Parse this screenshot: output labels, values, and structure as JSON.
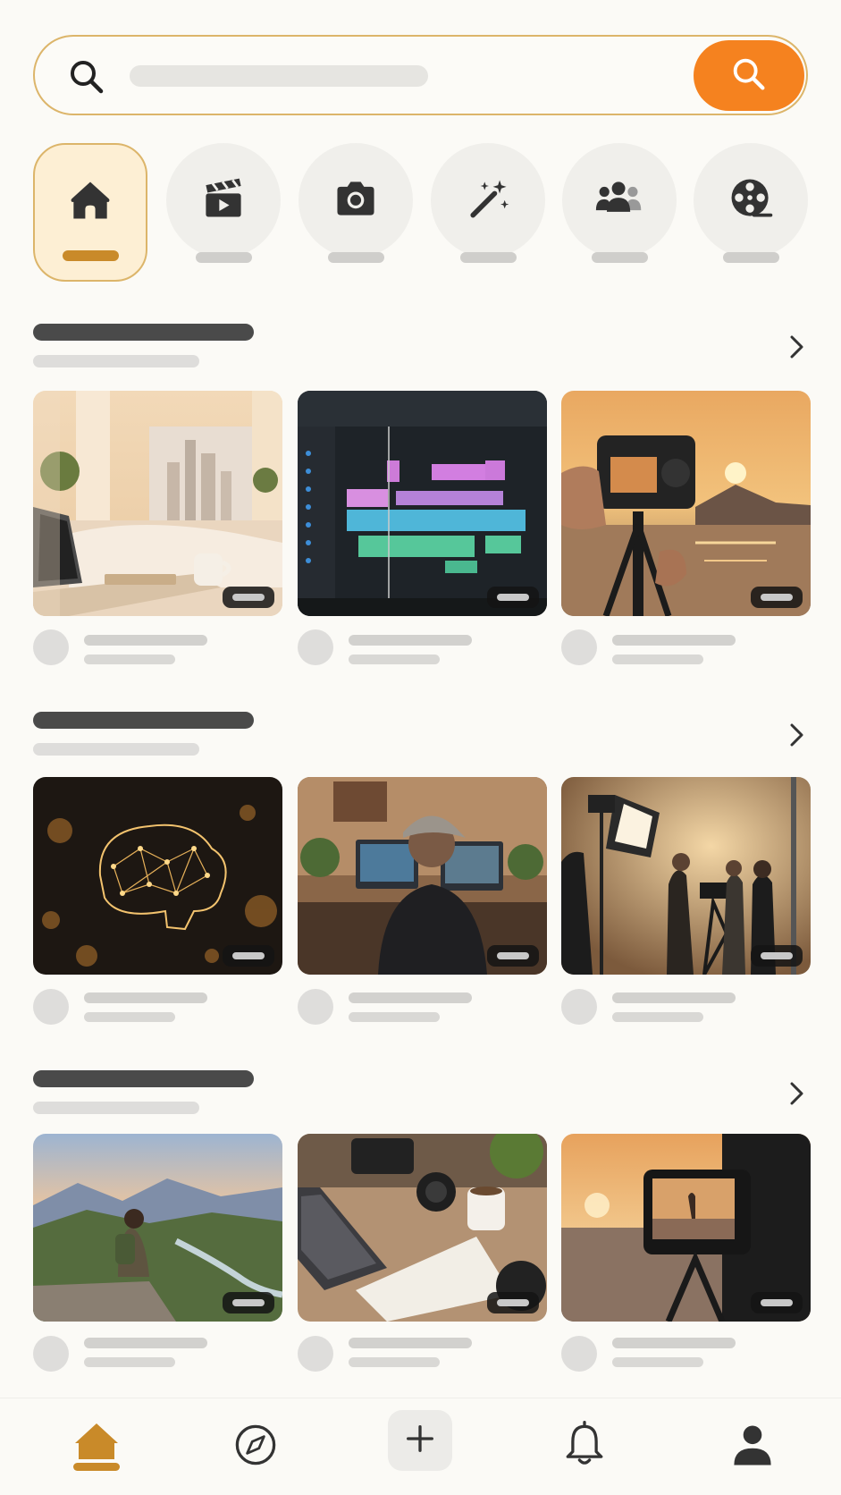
{
  "search": {
    "placeholder": "",
    "value": ""
  },
  "categories": [
    {
      "name": "home",
      "icon": "home-icon",
      "label": "",
      "active": true
    },
    {
      "name": "film",
      "icon": "clapperboard-icon",
      "label": "",
      "active": false
    },
    {
      "name": "photo",
      "icon": "camera-icon",
      "label": "",
      "active": false
    },
    {
      "name": "effects",
      "icon": "magic-wand-icon",
      "label": "",
      "active": false
    },
    {
      "name": "community",
      "icon": "group-icon",
      "label": "",
      "active": false
    },
    {
      "name": "reels",
      "icon": "film-reel-icon",
      "label": "",
      "active": false
    }
  ],
  "sections": [
    {
      "title": "",
      "subtitle": "",
      "cards": [
        {
          "image": "sunlit-home-office-with-laptop-and-coffee",
          "duration": "",
          "author": "",
          "meta": ""
        },
        {
          "image": "video-editing-timeline-on-monitor",
          "duration": "",
          "author": "",
          "meta": ""
        },
        {
          "image": "camera-on-tripod-at-sunset-over-water",
          "duration": "",
          "author": "",
          "meta": ""
        }
      ]
    },
    {
      "title": "",
      "subtitle": "",
      "cards": [
        {
          "image": "glowing-neural-network-brain",
          "duration": "",
          "author": "",
          "meta": ""
        },
        {
          "image": "editor-at-desk-with-two-monitors",
          "duration": "",
          "author": "",
          "meta": ""
        },
        {
          "image": "film-crew-in-studio-with-lights",
          "duration": "",
          "author": "",
          "meta": ""
        }
      ]
    },
    {
      "title": "",
      "subtitle": "",
      "cards": [
        {
          "image": "hiker-overlooking-mountain-valley",
          "duration": "",
          "author": "",
          "meta": ""
        },
        {
          "image": "desk-with-laptop-notebook-lens-and-coffee",
          "duration": "",
          "author": "",
          "meta": ""
        },
        {
          "image": "camera-monitor-filming-sunset",
          "duration": "",
          "author": "",
          "meta": ""
        }
      ]
    }
  ],
  "bottom_nav": [
    {
      "name": "home",
      "icon": "home-icon",
      "label": "",
      "active": true
    },
    {
      "name": "explore",
      "icon": "compass-icon",
      "label": "",
      "active": false
    },
    {
      "name": "create",
      "icon": "plus-icon",
      "label": "",
      "active": false
    },
    {
      "name": "notifications",
      "icon": "bell-icon",
      "label": "",
      "active": false
    },
    {
      "name": "profile",
      "icon": "user-icon",
      "label": "",
      "active": false
    }
  ],
  "colors": {
    "accent": "#f5821f",
    "active_gold": "#c98a29",
    "active_bg": "#fdefd4",
    "background": "#fbfaf6",
    "icon_dark": "#333333"
  }
}
